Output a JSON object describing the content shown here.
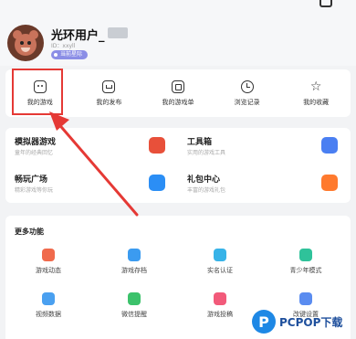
{
  "profile": {
    "username": "光环用户_",
    "uid": "ID：xxyll",
    "badge": "当前星际"
  },
  "tabs": [
    {
      "label": "我的游戏",
      "icon": "gamepad-icon"
    },
    {
      "label": "我的发布",
      "icon": "publish-icon"
    },
    {
      "label": "我的游戏单",
      "icon": "game-list-icon"
    },
    {
      "label": "浏览记录",
      "icon": "clock-icon"
    },
    {
      "label": "我的收藏",
      "icon": "star-icon"
    }
  ],
  "features": [
    {
      "title": "模拟器游戏",
      "subtitle": "童年的经典回忆",
      "color": "#e8503a"
    },
    {
      "title": "工具箱",
      "subtitle": "实用的游戏工具",
      "color": "#4a7ff2"
    },
    {
      "title": "畅玩广场",
      "subtitle": "精彩游戏等你玩",
      "color": "#2b8ef5"
    },
    {
      "title": "礼包中心",
      "subtitle": "丰富的游戏礼包",
      "color": "#ff7a2e"
    }
  ],
  "more": {
    "title": "更多功能",
    "items": [
      {
        "label": "游戏动态",
        "color": "#f06a4c"
      },
      {
        "label": "游戏存档",
        "color": "#3b9bf0"
      },
      {
        "label": "实名认证",
        "color": "#37b3e8"
      },
      {
        "label": "青少年模式",
        "color": "#2fc29a"
      },
      {
        "label": "视频数据",
        "color": "#4aa0f0"
      },
      {
        "label": "微信提醒",
        "color": "#3cc26b"
      },
      {
        "label": "游戏投稿",
        "color": "#f25a7a"
      },
      {
        "label": "改键设置",
        "color": "#5a8cf0"
      }
    ]
  },
  "watermark": {
    "text": "PCPOP下载",
    "logo": "P"
  },
  "colors": {
    "highlight": "#e53935"
  }
}
